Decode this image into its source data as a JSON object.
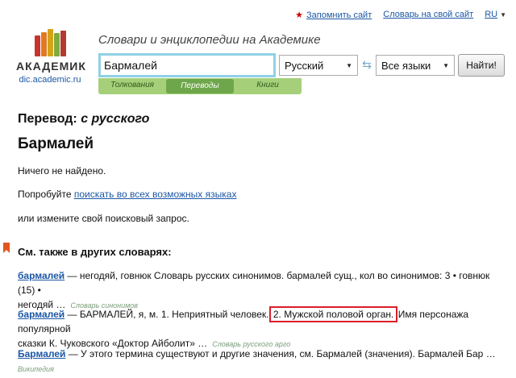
{
  "toplinks": {
    "bookmark": "Запомнить сайт",
    "dictionary": "Словарь на свой сайт",
    "lang": "RU"
  },
  "logo": {
    "word": "АКАДЕМИК",
    "domain": "dic.academic.ru"
  },
  "tagline": "Словари и энциклопедии на Академике",
  "search": {
    "value": "Бармалей",
    "from_lang": "Русский",
    "to_lang": "Все языки",
    "submit": "Найти!"
  },
  "tabs": [
    "Толкования",
    "Переводы",
    "Книги"
  ],
  "content": {
    "heading_prefix": "Перевод:",
    "heading_suffix": "с русского",
    "word": "Бармалей",
    "not_found": "Ничего не найдено.",
    "try_prefix": "Попробуйте",
    "try_link": "поискать во всех возможных языках",
    "or_change": "или измените свой поисковый запрос."
  },
  "see_also": {
    "title": "См. также в других словарях:",
    "entries": [
      {
        "word": "бармалей",
        "text1": " — негодяй, говнюк Словарь русских синонимов. бармалей сущ., кол во синонимов: 3 • говнюк (15) •",
        "text2": "негодяй …",
        "source": "Словарь синонимов"
      },
      {
        "word": "бармалей",
        "text1a": " — БАРМАЛЕЙ, я, м. 1. Неприятный человек.",
        "highlight": "2. Мужской половой орган.",
        "text1b": " Имя персонажа популярной",
        "text2": "сказки К. Чуковского «Доктор Айболит» …",
        "source": "Словарь русского арго"
      },
      {
        "word": "Бармалей",
        "text1": " — У этого термина существуют и другие значения, см. Бармалей (значения). Бармалей Бар …",
        "source": "Википедия"
      }
    ]
  },
  "colors": {
    "link": "#1c57a5",
    "tabs_bg": "#a6cf7a",
    "tab_active": "#6ea74b",
    "highlight_border": "#d9202a",
    "search_border": "#8fd1e6"
  }
}
